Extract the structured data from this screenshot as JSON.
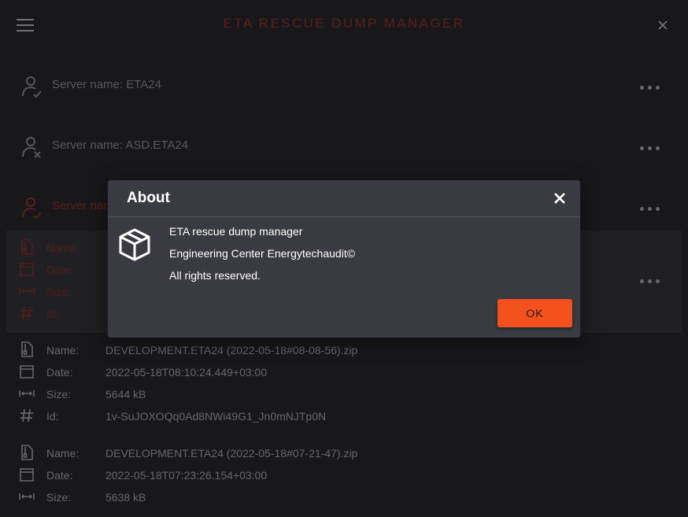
{
  "app": {
    "title": "ETA RESCUE DUMP MANAGER"
  },
  "servers": [
    {
      "label": "Server name: ETA24",
      "status": "connected"
    },
    {
      "label": "Server name: ASD.ETA24",
      "status": "disconnected"
    },
    {
      "label": "Server name: ETA24",
      "status": "active"
    }
  ],
  "dump_labels": {
    "name": "Name:",
    "date": "Date:",
    "size": "Size:",
    "id": "Id:"
  },
  "dumps": [
    {
      "name": "",
      "date": "",
      "size": "",
      "id": ""
    },
    {
      "name": "DEVELOPMENT.ETA24 (2022-05-18#08-08-56).zip",
      "date": "2022-05-18T08:10:24.449+03:00",
      "size": "5644 kB",
      "id": "1v-SuJOXOQq0Ad8NWi49G1_Jn0mNJTp0N"
    },
    {
      "name": "DEVELOPMENT.ETA24 (2022-05-18#07-21-47).zip",
      "date": "2022-05-18T07:23:26.154+03:00",
      "size": "5638 kB"
    }
  ],
  "dialog": {
    "title": "About",
    "line1": "ETA rescue dump manager",
    "line2": "Engineering Center Energytechaudit©",
    "line3": "All rights reserved.",
    "ok_label": "OK"
  },
  "colors": {
    "background": "#202024",
    "accent": "#f4511e",
    "active_dim": "#7b2a22",
    "dialog_bg": "#3a3a42"
  },
  "icons": {
    "menu": "hamburger-menu-icon",
    "close": "close-icon",
    "server_ok": "user-check-icon",
    "server_err": "user-x-icon",
    "more": "more-horizontal-icon",
    "file": "zip-file-icon",
    "date": "calendar-icon",
    "size": "width-arrows-icon",
    "id": "hash-icon",
    "about": "package-box-icon"
  }
}
